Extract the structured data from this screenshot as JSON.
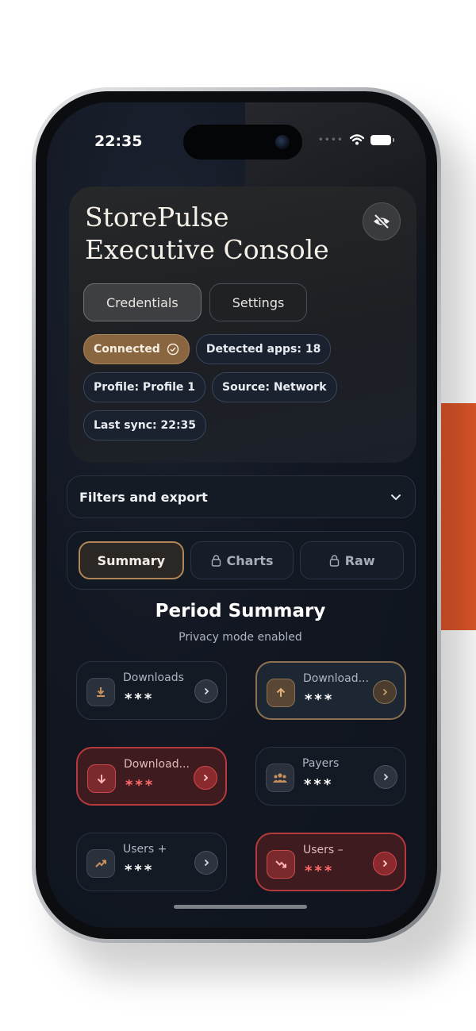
{
  "status_bar": {
    "time": "22:35"
  },
  "header": {
    "title_line1": "StorePulse",
    "title_line2": "Executive Console",
    "buttons": {
      "credentials": "Credentials",
      "settings": "Settings"
    },
    "chips": {
      "connected": "Connected",
      "detected_apps": "Detected apps: 18",
      "profile": "Profile: Profile 1",
      "source": "Source: Network",
      "last_sync": "Last sync: 22:35"
    }
  },
  "filters": {
    "label": "Filters and export"
  },
  "tabs": {
    "summary": "Summary",
    "charts": "Charts",
    "raw": "Raw"
  },
  "summary": {
    "title": "Period Summary",
    "subtitle": "Privacy mode enabled",
    "metrics": [
      {
        "label": "Downloads",
        "value": "***",
        "icon": "download-icon",
        "style": "neutral"
      },
      {
        "label": "Download...",
        "value": "***",
        "icon": "arrow-up-icon",
        "style": "gold"
      },
      {
        "label": "Download...",
        "value": "***",
        "icon": "arrow-down-icon",
        "style": "red"
      },
      {
        "label": "Payers",
        "value": "***",
        "icon": "users-icon",
        "style": "neutral"
      },
      {
        "label": "Users +",
        "value": "***",
        "icon": "trend-up-icon",
        "style": "neutral"
      },
      {
        "label": "Users –",
        "value": "***",
        "icon": "trend-down-icon",
        "style": "red"
      }
    ]
  },
  "colors": {
    "accent": "#e0572a",
    "gold": "#b08558",
    "danger": "#d1474c"
  }
}
